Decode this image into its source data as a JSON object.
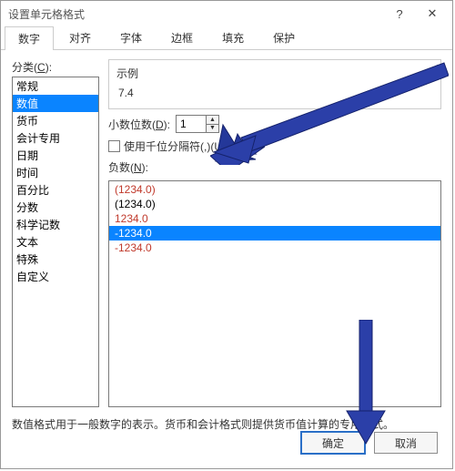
{
  "window": {
    "title": "设置单元格格式",
    "help_icon": "?",
    "close_icon": "✕"
  },
  "tabs": [
    "数字",
    "对齐",
    "字体",
    "边框",
    "填充",
    "保护"
  ],
  "tabs_active_index": 0,
  "category": {
    "label_pre": "分类",
    "label_u": "C",
    "label_post": ":",
    "items": [
      "常规",
      "数值",
      "货币",
      "会计专用",
      "日期",
      "时间",
      "百分比",
      "分数",
      "科学记数",
      "文本",
      "特殊",
      "自定义"
    ],
    "selected_index": 1
  },
  "example": {
    "title": "示例",
    "value": "7.4"
  },
  "decimals": {
    "label_pre": "小数位数(",
    "label_u": "D",
    "label_post": "):",
    "value": "1"
  },
  "thousands": {
    "label_pre": "使用千位分隔符(,)(",
    "label_u": "U",
    "label_post": ")",
    "checked": false
  },
  "negative": {
    "label_pre": "负数(",
    "label_u": "N",
    "label_post": "):",
    "items": [
      {
        "text": "(1234.0)",
        "cls": "red"
      },
      {
        "text": "(1234.0)",
        "cls": "black"
      },
      {
        "text": "1234.0",
        "cls": "red"
      },
      {
        "text": "-1234.0",
        "cls": "black",
        "selected": true
      },
      {
        "text": "-1234.0",
        "cls": "red"
      }
    ]
  },
  "description": "数值格式用于一般数字的表示。货币和会计格式则提供货币值计算的专用格式。",
  "buttons": {
    "ok": "确定",
    "cancel": "取消"
  }
}
